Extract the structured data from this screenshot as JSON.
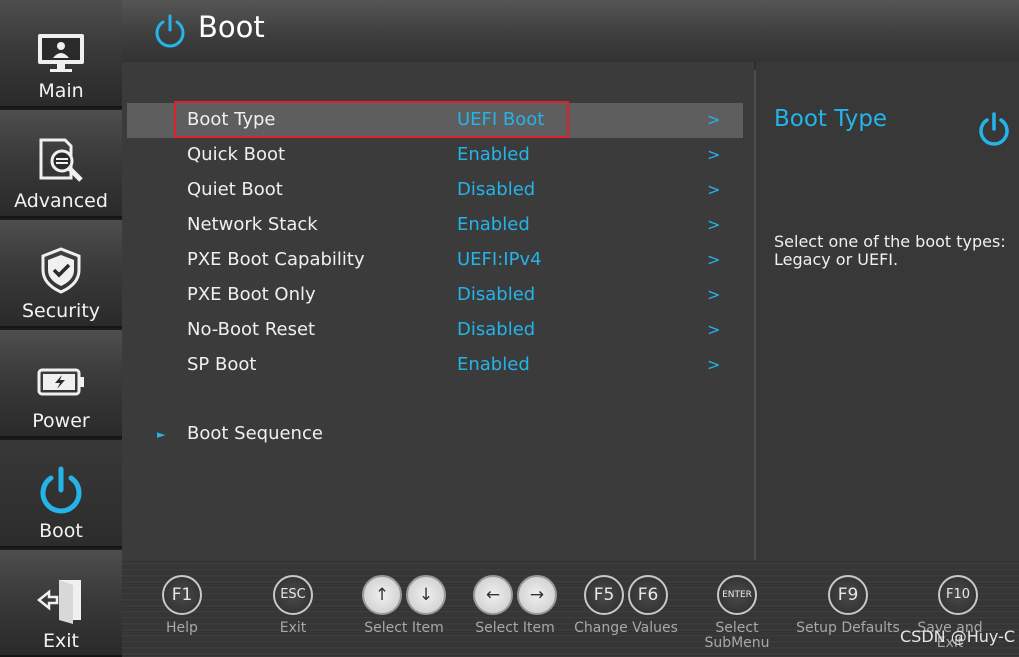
{
  "sidebar": {
    "items": [
      {
        "label": "Main",
        "icon": "monitor-icon"
      },
      {
        "label": "Advanced",
        "icon": "magnifier-icon"
      },
      {
        "label": "Security",
        "icon": "shield-icon"
      },
      {
        "label": "Power",
        "icon": "battery-icon"
      },
      {
        "label": "Boot",
        "icon": "power-icon",
        "active": true
      },
      {
        "label": "Exit",
        "icon": "exit-door-icon"
      }
    ]
  },
  "header": {
    "title": "Boot",
    "icon": "power-icon"
  },
  "settings": [
    {
      "name": "Boot Type",
      "value": "UEFI Boot",
      "arrow": ">"
    },
    {
      "name": "Quick Boot",
      "value": "Enabled",
      "arrow": ">"
    },
    {
      "name": "Quiet Boot",
      "value": "Disabled",
      "arrow": ">"
    },
    {
      "name": "Network Stack",
      "value": "Enabled",
      "arrow": ">"
    },
    {
      "name": "PXE Boot Capability",
      "value": "UEFI:IPv4",
      "arrow": ">"
    },
    {
      "name": "PXE Boot Only",
      "value": "Disabled",
      "arrow": ">"
    },
    {
      "name": "No-Boot Reset",
      "value": "Disabled",
      "arrow": ">"
    },
    {
      "name": "SP Boot",
      "value": "Enabled",
      "arrow": ">"
    }
  ],
  "submenu": {
    "label": "Boot Sequence",
    "bullet": "►"
  },
  "help": {
    "title": "Boot Type",
    "text": "Select one of the boot types: Legacy or UEFI."
  },
  "footer": {
    "keys": [
      {
        "buttons": [
          "F1"
        ],
        "label": "Help"
      },
      {
        "buttons": [
          "ESC"
        ],
        "label": "Exit"
      },
      {
        "buttons": [
          "↑",
          "↓"
        ],
        "label": "Select Item"
      },
      {
        "buttons": [
          "←",
          "→"
        ],
        "label": "Select Item"
      },
      {
        "buttons": [
          "F5",
          "F6"
        ],
        "label": "Change Values"
      },
      {
        "buttons": [
          "ENTER"
        ],
        "label": "Select SubMenu"
      },
      {
        "buttons": [
          "F9"
        ],
        "label": "Setup Defaults"
      },
      {
        "buttons": [
          "F10"
        ],
        "label": "Save and Exit"
      }
    ]
  },
  "watermark": "CSDN @Huy-C",
  "colors": {
    "accent": "#25b4ea",
    "highlight_border": "#e0202a"
  }
}
